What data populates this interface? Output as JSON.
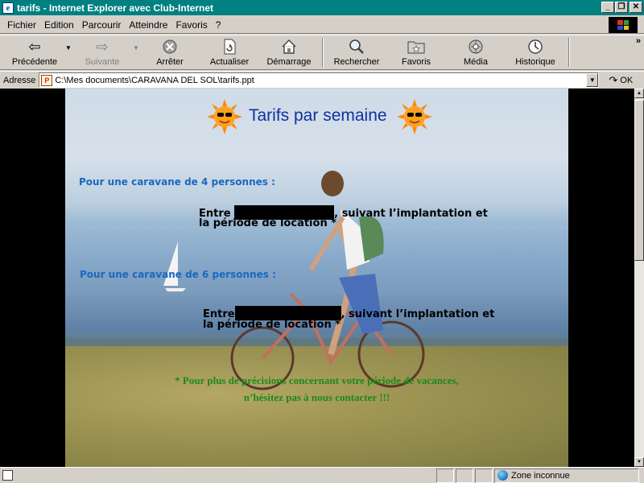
{
  "window": {
    "title": "tarifs - Internet Explorer avec Club-Internet",
    "minimize_icon": "minimize-icon",
    "maximize_icon": "restore-icon",
    "close_icon": "close-icon"
  },
  "menu": {
    "items": [
      "Fichier",
      "Edition",
      "Parcourir",
      "Atteindre",
      "Favoris",
      "?"
    ]
  },
  "toolbar": {
    "back": "Précédente",
    "forward": "Suivante",
    "stop": "Arrêter",
    "refresh": "Actualiser",
    "home": "Démarrage",
    "search": "Rechercher",
    "favorites": "Favoris",
    "media": "Média",
    "history": "Historique"
  },
  "address": {
    "label": "Adresse",
    "value": "C:\\Mes documents\\CARAVANA DEL SOL\\tarifs.ppt",
    "go": "OK"
  },
  "slide": {
    "title": "Tarifs par semaine",
    "section1_heading": "Pour une caravane de 4 personnes :",
    "section1_prefix": "Entre",
    "section1_suffix": ", suivant l’implantation et",
    "section1_line2": "la période de location *",
    "section2_heading": "Pour une caravane de 6 personnes :",
    "section2_prefix": "Entre",
    "section2_suffix": ", suivant l’implantation et",
    "section2_line2": "la période de location *",
    "note_line1": "* Pour plus de précisions concernant votre période de vacances,",
    "note_line2": "n’hésitez pas à nous contacter  !!!"
  },
  "status": {
    "zone": "Zone inconnue"
  },
  "colors": {
    "titlebar": "#008080",
    "slide_title": "#1030a0",
    "section_heading": "#1a68c0",
    "note": "#1a8a1a"
  }
}
